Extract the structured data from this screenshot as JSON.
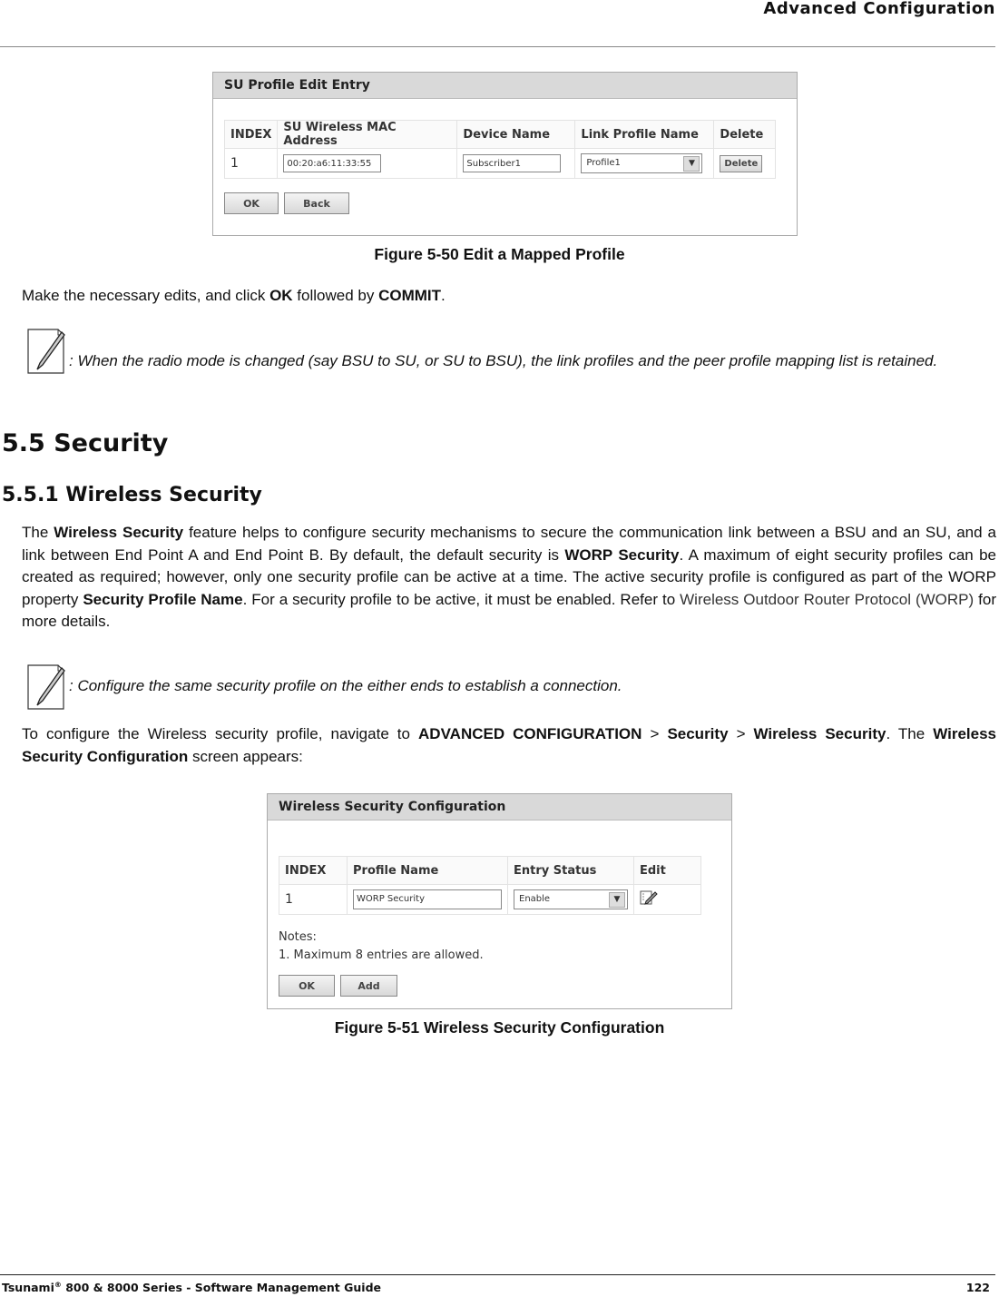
{
  "header": {
    "title": "Advanced Configuration"
  },
  "footer": {
    "doc_title": "Tsunami",
    "doc_title_mark": "®",
    "doc_title_rest": " 800 & 8000 Series - Software Management Guide",
    "page_number": "122"
  },
  "figure1": {
    "panel_title": "SU Profile Edit Entry",
    "columns": [
      "INDEX",
      "SU Wireless MAC Address",
      "Device Name",
      "Link Profile Name",
      "Delete"
    ],
    "row": {
      "index": "1",
      "mac": "00:20:a6:11:33:55",
      "device_name": "Subscriber1",
      "link_profile": "Profile1",
      "delete_label": "Delete"
    },
    "buttons": {
      "ok": "OK",
      "back": "Back"
    },
    "caption": "Figure 5-50 Edit a Mapped Profile"
  },
  "para1": {
    "t1": "Make the necessary edits, and click ",
    "b1": "OK",
    "t2": " followed by ",
    "b2": "COMMIT",
    "t3": "."
  },
  "note1": {
    "text": ": When the radio mode is changed (say BSU to SU, or SU to BSU), the link profiles and the peer profile mapping list is retained."
  },
  "section": {
    "h2": "5.5 Security",
    "h3": "5.5.1 Wireless Security"
  },
  "para2": {
    "t1": "The ",
    "b1": "Wireless Security",
    "t2": " feature helps to configure security mechanisms to secure the communication link between a BSU and an SU, and a link between End Point A and End Point B. By default, the default security is ",
    "b2": "WORP Security",
    "t3": ". A maximum of eight security profiles can be created as required; however, only one security profile can be active at a time. The active security profile is configured as part of the WORP property ",
    "b3": "Security Profile Name",
    "t4": ". For a security profile to be active, it must be enabled. Refer to ",
    "link": "Wireless Outdoor Router Protocol (WORP)",
    "t5": " for more details."
  },
  "note2": {
    "text": ": Configure the same security profile on the either ends to establish a connection."
  },
  "para3": {
    "t1": "To configure the Wireless security profile, navigate to ",
    "b1": "ADVANCED CONFIGURATION",
    "t2": " > ",
    "b2": "Security",
    "t3": " > ",
    "b3": "Wireless Security",
    "t4": ". The ",
    "b4": "Wireless Security Configuration",
    "t5": " screen appears:"
  },
  "figure2": {
    "panel_title": "Wireless Security Configuration",
    "columns": [
      "INDEX",
      "Profile Name",
      "Entry Status",
      "Edit"
    ],
    "row": {
      "index": "1",
      "profile_name": "WORP Security",
      "entry_status": "Enable"
    },
    "notes_title": "Notes:",
    "notes_item": "1. Maximum 8 entries are allowed.",
    "buttons": {
      "ok": "OK",
      "add": "Add"
    },
    "caption": "Figure 5-51 Wireless Security Configuration"
  }
}
